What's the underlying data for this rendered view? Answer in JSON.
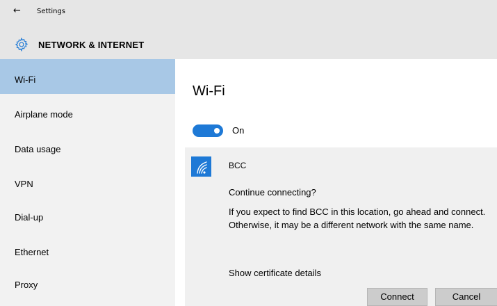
{
  "header": {
    "back_icon": "back-arrow-icon",
    "app_title": "Settings",
    "section_icon": "gear-icon",
    "section_title": "NETWORK & INTERNET"
  },
  "sidebar": {
    "items": [
      {
        "label": "Wi-Fi",
        "active": true
      },
      {
        "label": "Airplane mode",
        "active": false
      },
      {
        "label": "Data usage",
        "active": false
      },
      {
        "label": "VPN",
        "active": false
      },
      {
        "label": "Dial-up",
        "active": false
      },
      {
        "label": "Ethernet",
        "active": false
      },
      {
        "label": "Proxy",
        "active": false
      }
    ]
  },
  "main": {
    "title": "Wi-Fi",
    "toggle": {
      "state_label": "On",
      "on": true
    },
    "network": {
      "icon": "wifi-signal-icon",
      "name": "BCC",
      "question": "Continue connecting?",
      "message": "If you expect to find BCC in this location, go ahead and connect. Otherwise, it may be a different network with the same name.",
      "cert_link": "Show certificate details",
      "connect_label": "Connect",
      "cancel_label": "Cancel"
    }
  },
  "colors": {
    "accent": "#1e79d6",
    "sidebar_active": "#a8c8e6",
    "header_bg": "#e6e6e6",
    "sidebar_bg": "#f2f2f2",
    "card_bg": "#f0f0f0"
  }
}
